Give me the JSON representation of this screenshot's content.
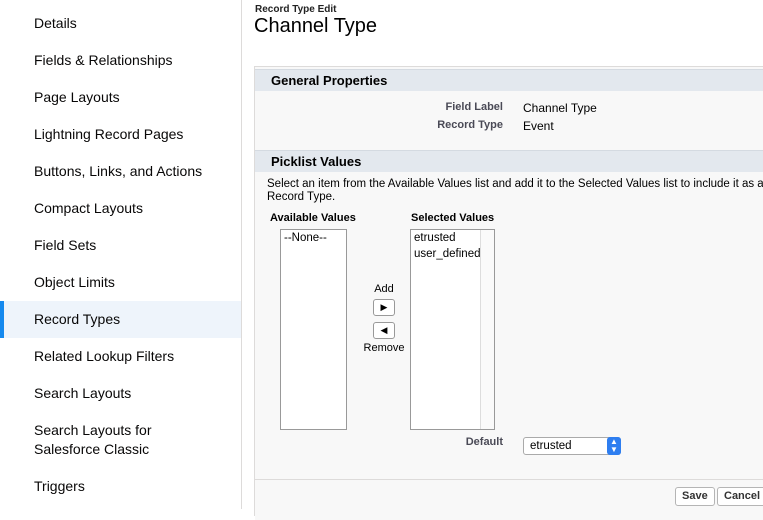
{
  "sidebar": {
    "items": [
      {
        "label": "Details"
      },
      {
        "label": "Fields & Relationships"
      },
      {
        "label": "Page Layouts"
      },
      {
        "label": "Lightning Record Pages"
      },
      {
        "label": "Buttons, Links, and Actions"
      },
      {
        "label": "Compact Layouts"
      },
      {
        "label": "Field Sets"
      },
      {
        "label": "Object Limits"
      },
      {
        "label": "Record Types",
        "active": true
      },
      {
        "label": "Related Lookup Filters"
      },
      {
        "label": "Search Layouts"
      },
      {
        "label": "Search Layouts for Salesforce Classic"
      },
      {
        "label": "Triggers"
      }
    ]
  },
  "header": {
    "breadcrumb": "Record Type Edit",
    "title": "Channel Type"
  },
  "general": {
    "heading": "General Properties",
    "field_label_label": "Field Label",
    "field_label_value": "Channel Type",
    "record_type_label": "Record Type",
    "record_type_value": "Event"
  },
  "picklist": {
    "heading": "Picklist Values",
    "description_line1": "Select an item from the Available Values list and add it to the Selected Values list to include it as a p",
    "description_line2": "Record Type.",
    "available_heading": "Available Values",
    "available_values": [
      "--None--"
    ],
    "selected_heading": "Selected Values",
    "selected_values": [
      "etrusted",
      "user_defined"
    ],
    "add_label": "Add",
    "remove_label": "Remove",
    "default_label": "Default",
    "default_value": "etrusted"
  },
  "footer": {
    "save_label": "Save",
    "cancel_label": "Cancel"
  },
  "colors": {
    "accent": "#1589ee",
    "section_header": "#e3e8ee",
    "select_caret": "#2e7ef0"
  }
}
